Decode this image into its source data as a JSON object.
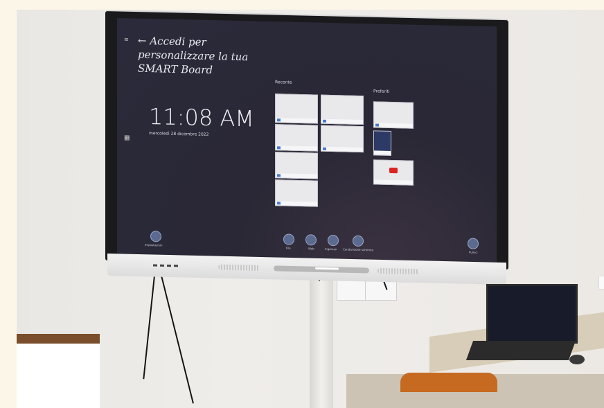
{
  "screen": {
    "signin_text": "← Accedi per personalizzare la tua SMART Board",
    "time": "11:08 AM",
    "date": "mercoledì 28 dicembre 2022",
    "recent_title": "Recente",
    "favorites_title": "Preferiti",
    "dock": [
      {
        "label": "Impostazioni",
        "icon": "settings-icon"
      },
      {
        "label": "File",
        "icon": "folder-icon"
      },
      {
        "label": "Web",
        "icon": "browser-icon"
      },
      {
        "label": "Ingresso",
        "icon": "input-icon"
      },
      {
        "label": "Condivisione schermo",
        "icon": "screen-share-icon"
      },
      {
        "label": "Pulisci",
        "icon": "clean-icon"
      }
    ]
  },
  "colors": {
    "screen_bg": "#2b2a3a",
    "wall": "#ece9e5",
    "chair": "#c66a22",
    "box_lid": "#7a4e2c"
  }
}
